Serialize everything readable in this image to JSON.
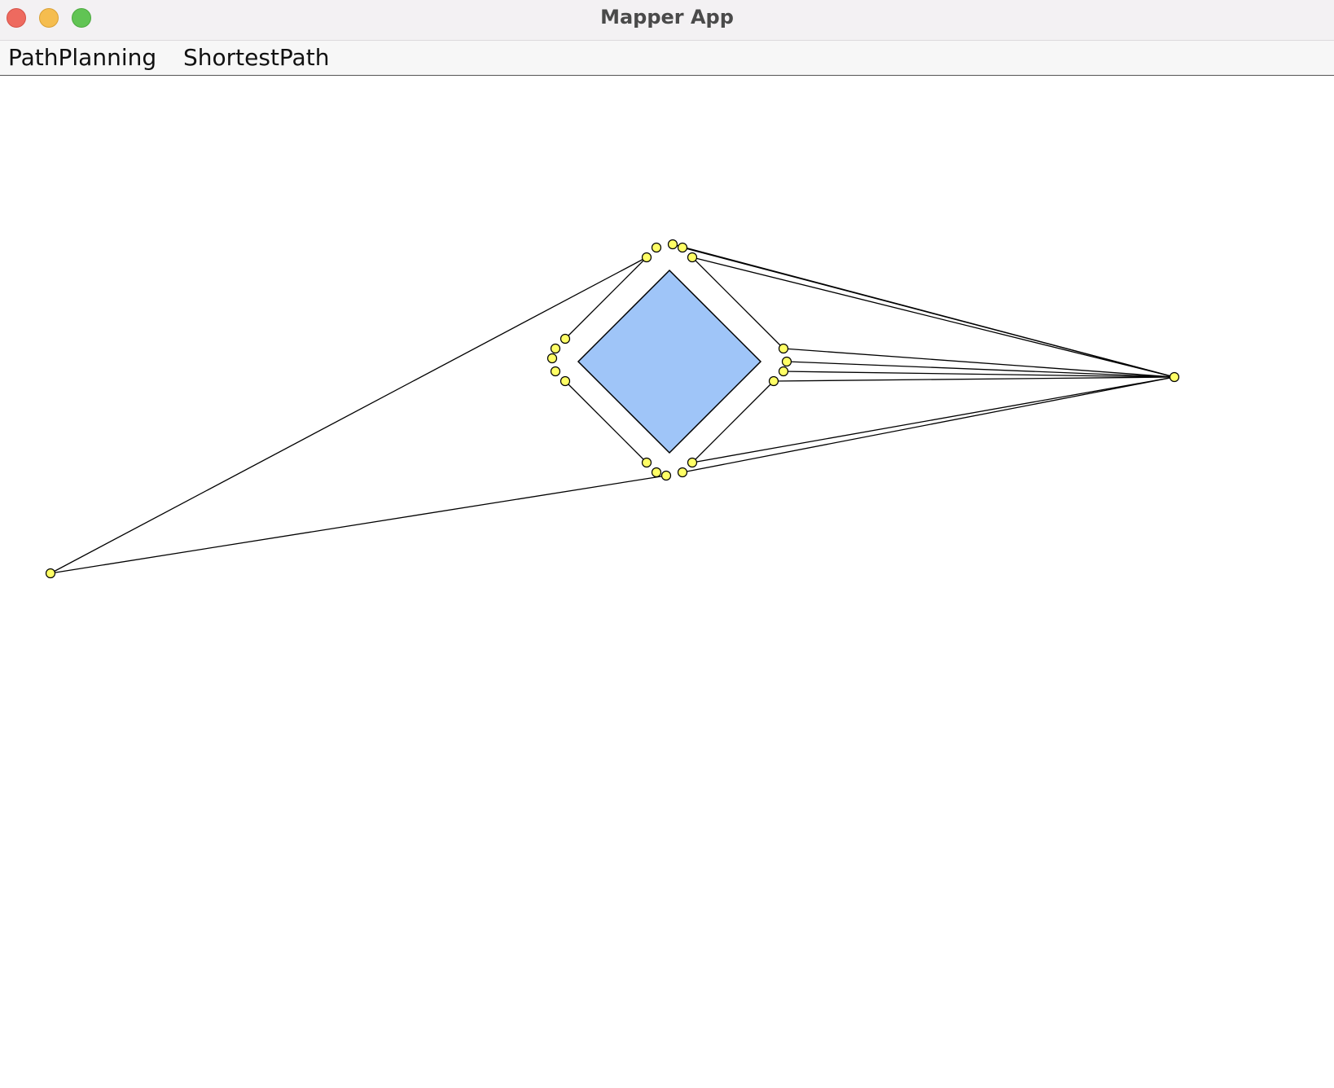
{
  "window": {
    "title": "Mapper App"
  },
  "menubar": {
    "items": [
      {
        "label": "PathPlanning"
      },
      {
        "label": "ShortestPath"
      }
    ]
  },
  "colors": {
    "obstacle_fill": "#9fc5f8",
    "node_fill": "#ffff66",
    "edge": "#000000"
  }
}
